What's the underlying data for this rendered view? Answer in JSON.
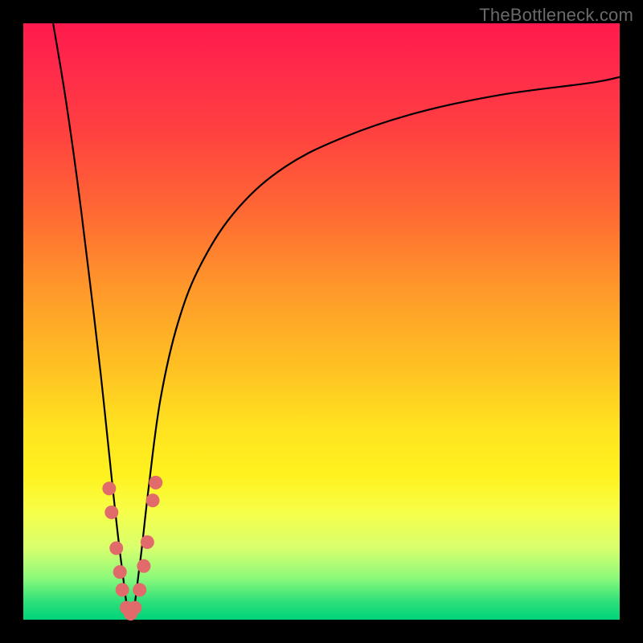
{
  "watermark": "TheBottleneck.com",
  "chart_data": {
    "type": "line",
    "title": "",
    "xlabel": "",
    "ylabel": "",
    "xlim": [
      0,
      100
    ],
    "ylim": [
      0,
      100
    ],
    "description": "V-shaped bottleneck curve on a vertical red-to-green gradient. Curve drops from top-left to a minimum near x≈18 at y≈0, then rises asymptotically toward the right.",
    "series": [
      {
        "name": "bottleneck-curve",
        "x": [
          5,
          7,
          9,
          11,
          13,
          15,
          16.5,
          18,
          19.5,
          21,
          23,
          26,
          30,
          36,
          44,
          54,
          66,
          80,
          95,
          100
        ],
        "values": [
          100,
          88,
          74,
          58,
          41,
          22,
          9,
          0,
          9,
          22,
          37,
          50,
          60,
          69,
          76,
          81,
          85,
          88,
          90,
          91
        ]
      }
    ],
    "markers": {
      "name": "highlight-points",
      "color": "#e16a6a",
      "points": [
        {
          "x": 14.4,
          "y": 22
        },
        {
          "x": 14.8,
          "y": 18
        },
        {
          "x": 15.6,
          "y": 12
        },
        {
          "x": 16.2,
          "y": 8
        },
        {
          "x": 16.6,
          "y": 5
        },
        {
          "x": 17.3,
          "y": 2
        },
        {
          "x": 18.0,
          "y": 1
        },
        {
          "x": 18.7,
          "y": 2
        },
        {
          "x": 19.5,
          "y": 5
        },
        {
          "x": 20.2,
          "y": 9
        },
        {
          "x": 20.8,
          "y": 13
        },
        {
          "x": 21.7,
          "y": 20
        },
        {
          "x": 22.2,
          "y": 23
        }
      ]
    },
    "gradient_colors": {
      "top": "#ff1a4d",
      "mid": "#ffe31f",
      "bottom": "#00d37a"
    }
  }
}
